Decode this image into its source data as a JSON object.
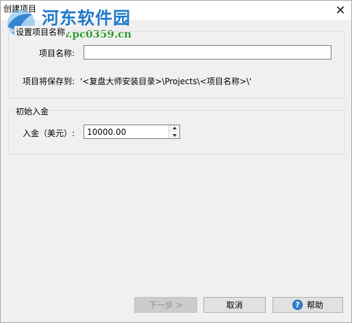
{
  "window": {
    "title": "创建项目",
    "close_glyph": "✕"
  },
  "watermark": {
    "site_name": "河东软件园",
    "url": "www.pc0359.cn"
  },
  "project_group": {
    "legend": "设置项目名称",
    "name_label": "项目名称:",
    "name_value": "",
    "save_path_label": "项目将保存到:",
    "save_path_value": "'<复盘大师安装目录>\\Projects\\<项目名称>\\'"
  },
  "capital_group": {
    "legend": "初始入金",
    "deposit_label": "入金（美元）:",
    "deposit_value": "10000.00"
  },
  "buttons": {
    "next_label": "下一步 >",
    "cancel_label": "取消",
    "help_label": "帮助",
    "help_icon_glyph": "?"
  },
  "colors": {
    "background": "#f0f0f0",
    "watermark_title": "#1f78c8",
    "watermark_url": "#2e9a2e",
    "help_icon": "#2f7fd6"
  }
}
